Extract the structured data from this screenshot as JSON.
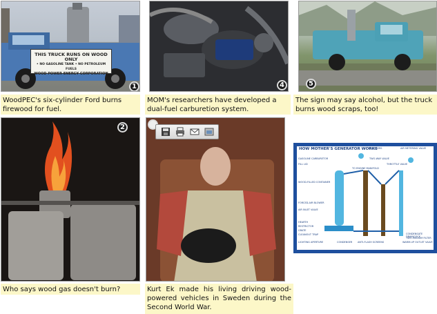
{
  "captions": [
    {
      "number": "1",
      "text": "WoodPEC's six-cylinder Ford burns firewood for fuel."
    },
    {
      "number": "4",
      "text": "MOM's researchers have developed a dual-fuel carburetion system."
    },
    {
      "number": "5",
      "text": "The sign may say alcohol, but the truck burns wood scraps, too!"
    },
    {
      "number": "2",
      "text": "Who says wood gas doesn't burn?"
    },
    {
      "number": "",
      "text": "Kurt Ek made his living driving wood-powered vehicles in Sweden during the Second World War."
    }
  ],
  "truck_sign": {
    "line1": "THIS TRUCK RUNS ON WOOD ONLY",
    "line2": "• NO GASOLINE TANK  • NO PETROLEUM FUELS",
    "line3": "WOOD POWER ENERGY CORPORATION"
  },
  "diagram": {
    "title": "HOW MOTHER'S GENERATOR WORKS",
    "labels": {
      "air_filters": "AIR FILTERS",
      "air_metering_valve": "AIR METERING VALVE",
      "gasoline_carburetor": "GASOLINE CARBURETOR",
      "two_way_valve": "TWO-WAY VALVE",
      "fill_lid": "FILL LID",
      "throttle_valve": "THROTTLE VALVE",
      "to_engine_manifold": "TO ENGINE MANIFOLD",
      "wood_filled_container": "WOOD-FILLED CONTAINER",
      "forced_air_blower": "FORCED-AIR BLOWER",
      "air_inlet_valve": "AIR INLET VALVE",
      "hearth": "HEARTH",
      "restrictor": "RESTRICTOR",
      "grate": "GRATE",
      "cleanout_trap": "CLEANOUT TRAP",
      "lighting_aperture": "LIGHTING APERTURE",
      "condenser": "CONDENSER",
      "anti_flash_screens": "ANTI-FLASH SCREENS",
      "condensate_drain_cock": "CONDENSATE DRAINCOCK",
      "two_medium_filter": "TWO-MEDIUM FILTER",
      "warm_up_outlet_valve": "WARM-UP OUTLET VALVE"
    }
  },
  "toolbar": {
    "buttons": [
      "save-icon",
      "print-icon",
      "email-icon",
      "folder-icon"
    ]
  }
}
